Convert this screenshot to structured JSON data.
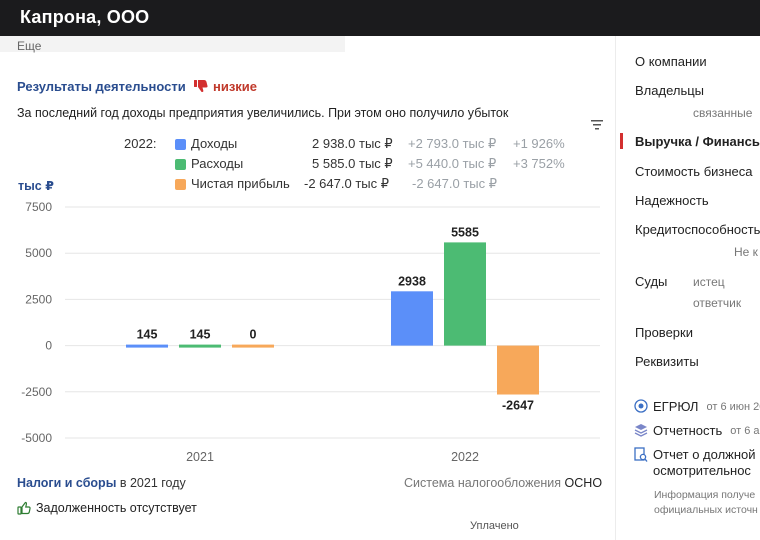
{
  "header": {
    "company": "Капрона, ООО",
    "more_link": "Еще"
  },
  "results": {
    "title": "Результаты деятельности",
    "rating": "низкие",
    "summary": "За последний год доходы предприятия увеличились. При этом оно получило убыток"
  },
  "legend": {
    "year": "2022:",
    "rows": [
      {
        "label": "Доходы",
        "value": "2 938.0 тыс ₽",
        "delta_abs": "+2 793.0 тыс ₽",
        "delta_pct": "+1 926%",
        "color": "#5b8ff9"
      },
      {
        "label": "Расходы",
        "value": "5 585.0 тыс ₽",
        "delta_abs": "+5 440.0 тыс ₽",
        "delta_pct": "+3 752%",
        "color": "#4cbb73"
      },
      {
        "label": "Чистая прибыль",
        "value": "-2 647.0 тыс ₽",
        "delta_abs": "-2 647.0 тыс ₽",
        "delta_pct": "",
        "color": "#f7a85a"
      }
    ]
  },
  "chart_data": {
    "type": "bar",
    "ylabel": "тыс ₽",
    "categories": [
      "2021",
      "2022"
    ],
    "series": [
      {
        "values": [
          145,
          2938
        ],
        "color": "#5b8ff9"
      },
      {
        "values": [
          145,
          5585
        ],
        "color": "#4cbb73"
      },
      {
        "values": [
          0,
          -2647
        ],
        "color": "#f7a85a"
      }
    ],
    "ylim": [
      -5000,
      7500
    ],
    "yticks": [
      7500,
      5000,
      2500,
      0,
      -2500,
      -5000
    ],
    "grid": true
  },
  "taxes": {
    "title": "Налоги и сборы",
    "year_text": "в 2021 году",
    "system_label": "Система налогообложения",
    "system_value": "ОСНО",
    "debt": "Задолженность отсутствует",
    "paid_label": "Уплачено"
  },
  "sidebar": {
    "about": "О компании",
    "owners": "Владельцы",
    "related": "связанные",
    "revenue": "Выручка / Финансы",
    "value": "Стоимость бизнеса",
    "reliability": "Надежность",
    "credit": "Кредитоспособность",
    "credit_note": "Не к",
    "courts": "Суды",
    "plaintiff": "истец",
    "defendant": "ответчик",
    "checks": "Проверки",
    "requisites": "Реквизиты",
    "egrul": "ЕГРЮЛ",
    "egrul_note": "от 6 июн 20",
    "report": "Отчетность",
    "report_note": "от 6 а",
    "diligence_1": "Отчет о должной",
    "diligence_2": "осмотрительнос",
    "info_1": "Информация получе",
    "info_2": "официальных источн",
    "accent": "#d32f2f"
  }
}
